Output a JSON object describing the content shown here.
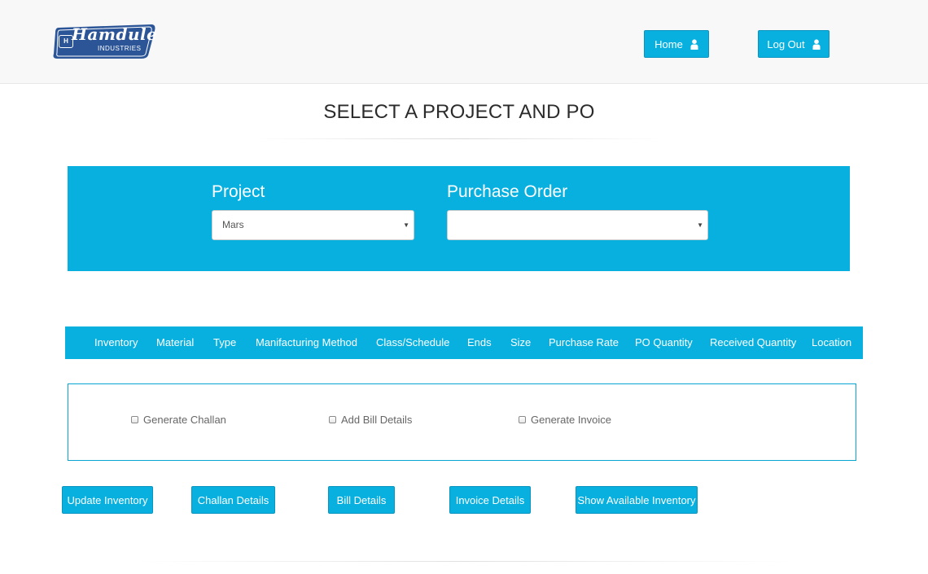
{
  "brand": {
    "name": "Hamdule",
    "subtitle": "INDUSTRIES",
    "monogram": "H",
    "color": "#2b5597"
  },
  "nav": {
    "home_label": "Home",
    "logout_label": "Log Out",
    "icon": "user-icon"
  },
  "page": {
    "title": "SELECT A PROJECT AND PO"
  },
  "selection": {
    "project_label": "Project",
    "project_value": "Mars",
    "po_label": "Purchase Order",
    "po_value": ""
  },
  "table": {
    "columns": [
      "Inventory",
      "Material",
      "Type",
      "Manifacturing Method",
      "Class/Schedule",
      "Ends",
      "Size",
      "Purchase Rate",
      "PO Quantity",
      "Received Quantity",
      "Location"
    ]
  },
  "options": {
    "generate_challan": "Generate Challan",
    "add_bill_details": "Add Bill Details",
    "generate_invoice": "Generate Invoice"
  },
  "actions": {
    "update_inventory": "Update Inventory",
    "challan_details": "Challan Details",
    "bill_details": "Bill Details",
    "invoice_details": "Invoice Details",
    "show_available_inventory": "Show Available Inventory"
  },
  "colors": {
    "accent": "#08b0e0",
    "header_bg": "#f8f8f8",
    "panel_border": "#08a5d3"
  }
}
